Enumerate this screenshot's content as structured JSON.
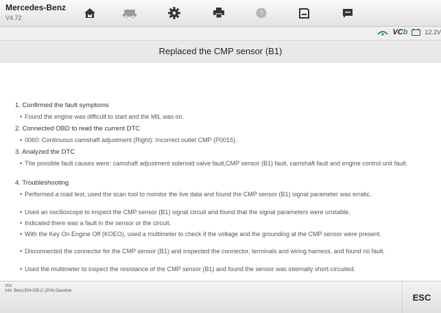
{
  "header": {
    "brand": "Mercedes-Benz",
    "version": "V4.72",
    "toolbar": [
      {
        "icon": "home-icon",
        "color": "#333333"
      },
      {
        "icon": "vehicle-swap-icon",
        "color": "#9a9a9a"
      },
      {
        "icon": "gear-icon",
        "color": "#333333"
      },
      {
        "icon": "printer-icon",
        "color": "#333333"
      },
      {
        "icon": "help-icon",
        "color": "#b5b5b5"
      },
      {
        "icon": "save-icon",
        "color": "#333333"
      },
      {
        "icon": "chat-icon",
        "color": "#333333"
      }
    ]
  },
  "status": {
    "vcb_text": "VC",
    "vcb_suffix": "b",
    "voltage": "12.2V",
    "accent": "#2a9d3f"
  },
  "page": {
    "title": "Replaced the CMP sensor (B1)"
  },
  "content": {
    "sections": [
      {
        "heading": "1. Confirmed the fault symptoms",
        "items": [
          "Found the engine was difficult to start and the MIL was on."
        ]
      },
      {
        "heading": "2. Connected OBD to read the current DTC",
        "items": [
          "0060: Continuous camshaft adjustment (Right): Incorrect outlet CMP (P0015)."
        ]
      },
      {
        "heading": "3. Analyzed the DTC",
        "items": [
          "The possible fault causes were: camshaft adjustment solenoid valve fault,CMP sensor (B1) fault, camshaft fault and engine control unit fault."
        ]
      },
      {
        "heading": "4. Troubleshooting",
        "items": [
          "Performed a road test, used the scan tool to monitor the live data and found the CMP sensor (B1) signal parameter was erratic.",
          "Used an oscilloscope to inspect the CMP sensor (B1) signal circuit and found that the signal parameters were unstable.",
          "Indicated there was a fault in the sensor or the circuit.",
          "With the Key On Engine Off (KOEO), used a multimeter to check if the voltage and the grounding at the CMP sensor were present.",
          "Disconnected the connector for the CMP sensor (B1) and inspected the connector, terminals and wiring harness, and found no fault.",
          "Used the multimeter to inspect the resistance of the CMP sensor (B1) and found the sensor was internally short-circuited."
        ]
      }
    ]
  },
  "footer": {
    "vin_label": "VIN",
    "info": "Info: Benz/204.055.C (204) Gasoline",
    "esc_label": "ESC"
  }
}
